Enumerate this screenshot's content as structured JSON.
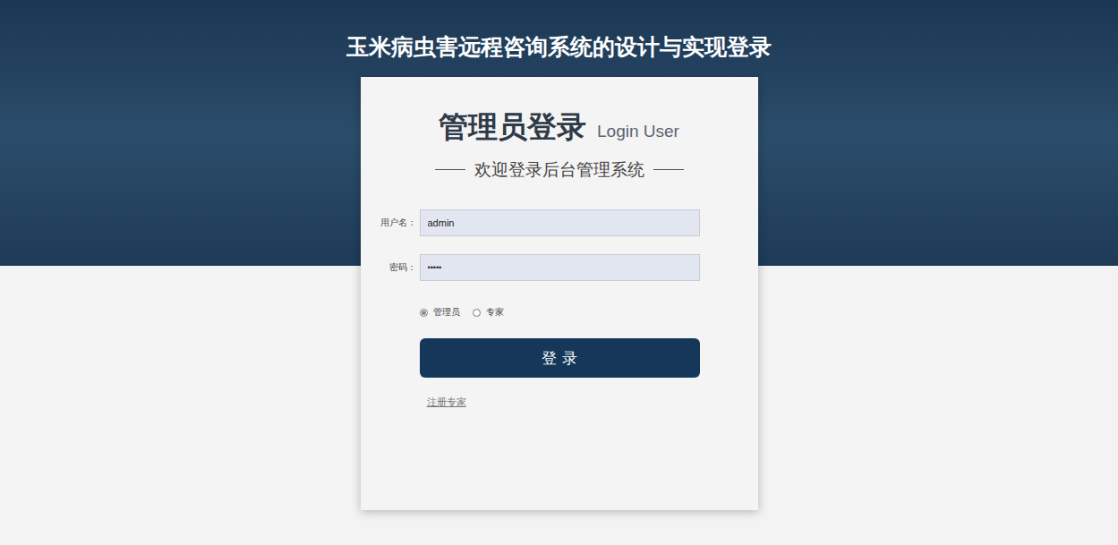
{
  "window": {
    "title": "玉米病虫害远程咨询系统的设计与实现登录"
  },
  "card": {
    "heading": "管理员登录",
    "heading_en": "Login User",
    "subtitle": "欢迎登录后台管理系统"
  },
  "fields": [
    {
      "label": "用户名：",
      "value": "admin",
      "kind": "text"
    },
    {
      "label": "密码：",
      "value": "•••••",
      "kind": "password"
    }
  ],
  "roles": [
    {
      "label": "管理员",
      "selected": true
    },
    {
      "label": "专家",
      "selected": false
    }
  ],
  "button": "登 录",
  "link": "注册专家"
}
